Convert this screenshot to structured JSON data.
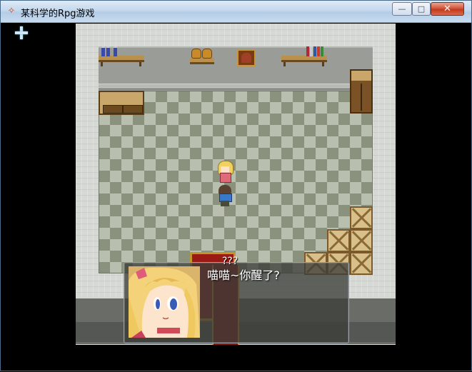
{
  "window": {
    "title": "某科学的Rpg游戏",
    "minimize_label": "—",
    "maximize_label": "□",
    "close_label": "✕"
  },
  "dialog": {
    "speaker": "???",
    "text": "喵喵~你醒了?"
  },
  "colors": {
    "floor_light": "#b9bfae",
    "floor_dark": "#8a917d",
    "wall": "#9a9c98",
    "carpet": "#9a1a14",
    "dialog_bg": "#3c3e3a"
  },
  "icons": [
    "app-icon",
    "cursor-move-icon"
  ]
}
